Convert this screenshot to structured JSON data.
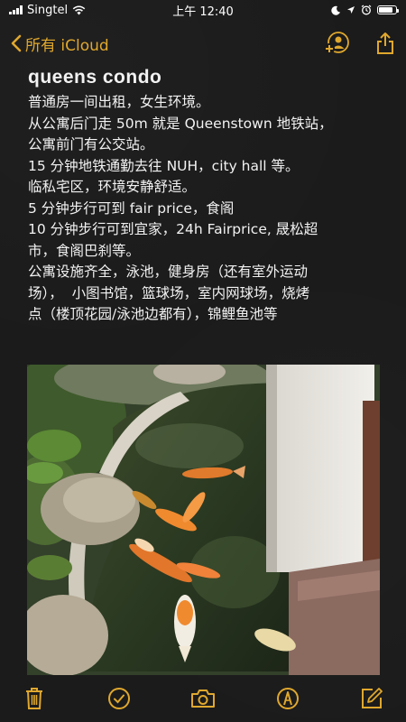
{
  "status_bar": {
    "carrier": "Singtel",
    "time": "上午 12:40",
    "battery_level": 0.85
  },
  "nav": {
    "back_label": "所有 iCloud"
  },
  "note": {
    "title": "queens  condo",
    "lines": [
      "普通房一间出租，女生环境。",
      "从公寓后门走 50m 就是 Queenstown 地铁站，",
      "公寓前门有公交站。",
      "15 分钟地铁通勤去往 NUH，city hall 等。",
      "临私宅区，环境安静舒适。",
      "5 分钟步行可到 fair price，食阁",
      "10 分钟步行可到宜家，24h Fairprice, 晟松超",
      "市，食阁巴刹等。",
      "公寓设施齐全，泳池，健身房（还有室外运动",
      "场），  小图书馆，篮球场，室内网球场，烧烤",
      "点（楼顶花园/泳池边都有），锦鲤鱼池等"
    ]
  },
  "icons": {
    "accent": "#e0a82e",
    "toolbar": [
      "trash-icon",
      "checklist-icon",
      "camera-icon",
      "markup-icon",
      "compose-icon"
    ]
  }
}
